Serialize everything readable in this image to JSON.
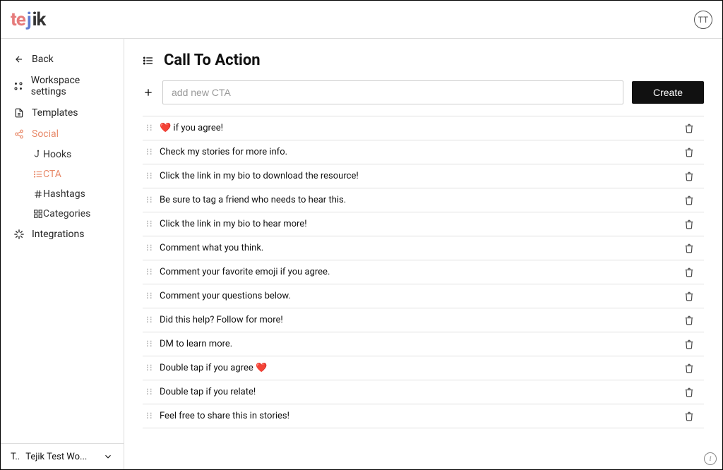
{
  "logo": {
    "text": "tejik"
  },
  "avatar": {
    "initials": "TT"
  },
  "sidebar": {
    "back": "Back",
    "workspace_settings": "Workspace settings",
    "templates": "Templates",
    "social": "Social",
    "social_children": {
      "hooks": "Hooks",
      "cta": "CTA",
      "hashtags": "Hashtags",
      "categories": "Categories"
    },
    "integrations": "Integrations"
  },
  "workspace_switcher": {
    "prefix": "T..",
    "name": "Tejik Test Wo..."
  },
  "main": {
    "title": "Call To Action",
    "add_placeholder": "add new CTA",
    "create_label": "Create"
  },
  "cta_items": [
    {
      "text": "❤️ if you agree!"
    },
    {
      "text": "Check my stories for more info."
    },
    {
      "text": "Click the link in my bio to download the resource!"
    },
    {
      "text": "Be sure to tag a friend who needs to hear this."
    },
    {
      "text": "Click the link in my bio to hear more!"
    },
    {
      "text": "Comment what you think."
    },
    {
      "text": "Comment your favorite emoji if you agree."
    },
    {
      "text": "Comment your questions below."
    },
    {
      "text": "Did this help? Follow for more!"
    },
    {
      "text": "DM to learn more."
    },
    {
      "text": "Double tap if you agree ❤️"
    },
    {
      "text": "Double tap if you relate!"
    },
    {
      "text": "Feel free to share this in stories!"
    }
  ]
}
